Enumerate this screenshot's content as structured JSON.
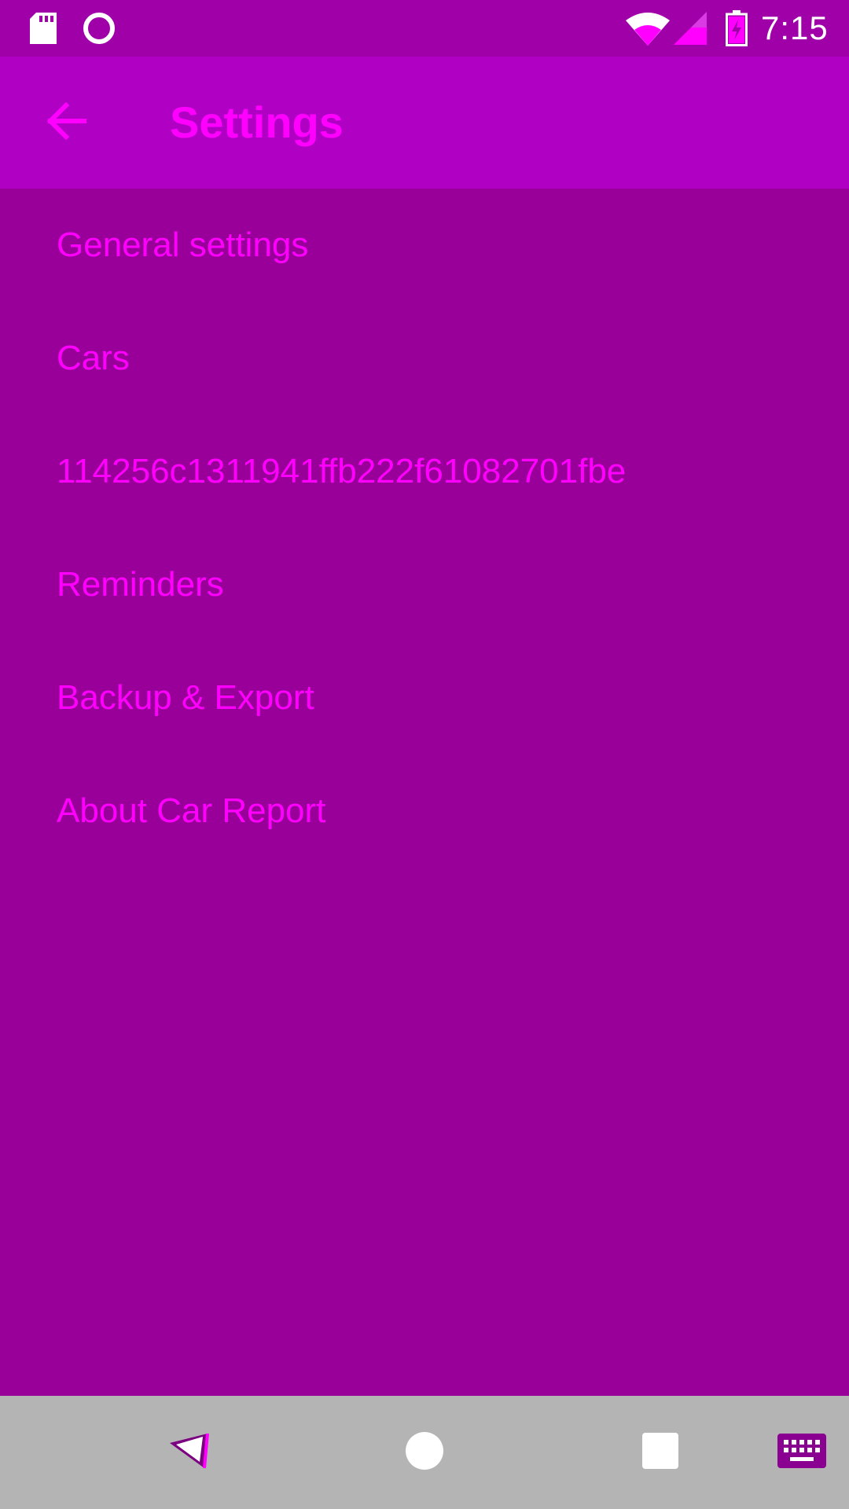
{
  "status_bar": {
    "time": "7:15",
    "icons": [
      "sd-card-icon",
      "sync-circle-icon",
      "wifi-icon",
      "cell-signal-icon",
      "battery-charging-icon"
    ]
  },
  "toolbar": {
    "back_icon": "arrow-back-icon",
    "title": "Settings"
  },
  "preferences": {
    "items": [
      {
        "label": "General settings"
      },
      {
        "label": "Cars"
      },
      {
        "label": "114256c1311941ffb222f61082701fbe"
      },
      {
        "label": "Reminders"
      },
      {
        "label": "Backup & Export"
      },
      {
        "label": "About Car Report"
      }
    ]
  },
  "nav_bar": {
    "buttons": [
      "back-triangle-icon",
      "home-circle-icon",
      "recents-square-icon",
      "keyboard-icon"
    ]
  },
  "colors": {
    "background": "#990099",
    "status_bar": "#a000a8",
    "toolbar": "#b000c4",
    "accent_text": "#ff00ff",
    "nav_bar": "#b4b4b4"
  }
}
